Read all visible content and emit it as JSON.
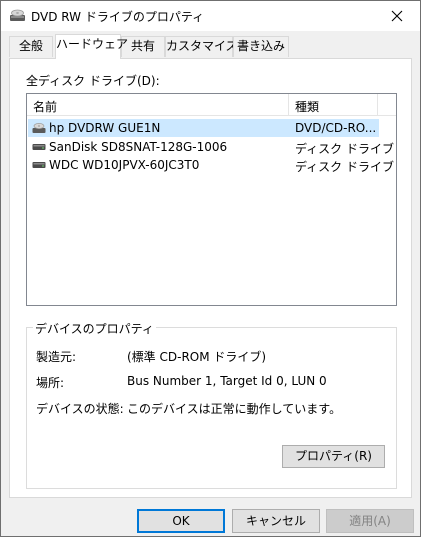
{
  "window": {
    "title": "DVD RW ドライブのプロパティ",
    "close_glyph": "✕"
  },
  "tabs": [
    {
      "label": "全般"
    },
    {
      "label": "ハードウェア",
      "active": true
    },
    {
      "label": "共有"
    },
    {
      "label": "カスタマイズ"
    },
    {
      "label": "書き込み"
    }
  ],
  "drives": {
    "label": "全ディスク ドライブ(D):",
    "columns": {
      "name": "名前",
      "type": "種類"
    },
    "rows": [
      {
        "name": "hp DVDRW GUE1N",
        "type": "DVD/CD-RO...",
        "icon": "dvd-drive-icon",
        "selected": true
      },
      {
        "name": "SanDisk SD8SNAT-128G-1006",
        "type": "ディスク ドライブ",
        "icon": "disk-drive-icon"
      },
      {
        "name": "WDC WD10JPVX-60JC3T0",
        "type": "ディスク ドライブ",
        "icon": "disk-drive-icon"
      }
    ]
  },
  "properties": {
    "title": "デバイスのプロパティ",
    "manufacturer_label": "製造元:",
    "manufacturer_value": "(標準 CD-ROM ドライブ)",
    "location_label": "場所:",
    "location_value": "Bus Number 1, Target Id 0, LUN 0",
    "status_label": "デバイスの状態:",
    "status_value": "このデバイスは正常に動作しています。",
    "properties_button": "プロパティ(R)"
  },
  "buttons": {
    "ok": "OK",
    "cancel": "キャンセル",
    "apply": "適用(A)"
  },
  "colors": {
    "selection": "#cce8ff",
    "default_button_border": "#0078d7"
  }
}
